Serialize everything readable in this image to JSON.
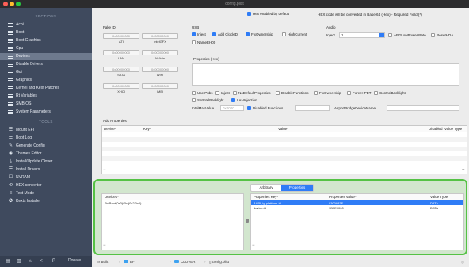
{
  "window": {
    "title": "config.plist"
  },
  "sidebar": {
    "sections_header": "SECTIONS",
    "items": [
      {
        "label": "Acpi"
      },
      {
        "label": "Boot"
      },
      {
        "label": "Boot Graphics"
      },
      {
        "label": "Cpu"
      },
      {
        "label": "Devices"
      },
      {
        "label": "Disable Drivers"
      },
      {
        "label": "Gui"
      },
      {
        "label": "Graphics"
      },
      {
        "label": "Kernel and Kext Patches"
      },
      {
        "label": "Rt Variables"
      },
      {
        "label": "SMBIOS"
      },
      {
        "label": "System Parameters"
      }
    ],
    "tools_header": "TOOLS",
    "tools": [
      {
        "label": "Mount EFI",
        "icon": "hdd-icon",
        "glyph": "☰"
      },
      {
        "label": "Boot Log",
        "icon": "log-icon",
        "glyph": "☰"
      },
      {
        "label": "Generate Config",
        "icon": "generate-icon",
        "glyph": "✎"
      },
      {
        "label": "Themes Editor",
        "icon": "themes-icon",
        "glyph": "◉"
      },
      {
        "label": "Install/Update Clover",
        "icon": "install-icon",
        "glyph": "⤓"
      },
      {
        "label": "Install Drivers",
        "icon": "drivers-icon",
        "glyph": "☰"
      },
      {
        "label": "NVRAM",
        "icon": "nvram-icon",
        "glyph": "☐"
      },
      {
        "label": "HEX converter",
        "icon": "hex-icon",
        "glyph": "⟲"
      },
      {
        "label": "Text Mode",
        "icon": "text-icon",
        "glyph": "≡"
      },
      {
        "label": "Kexts Installer",
        "icon": "kexts-icon",
        "glyph": "✪"
      }
    ],
    "donate": "Donate"
  },
  "top_bar": {
    "hex_checkbox": "Hex enabled by default",
    "hex_note": "HEX code will be converted in Base 64 (Hex) - Required Field (*)"
  },
  "fake_id": {
    "title": "Fake ID",
    "buttons": [
      {
        "value": "0x00000000",
        "caption": "ATI"
      },
      {
        "value": "0x00000000",
        "caption": "IntelGFX"
      },
      {
        "value": "0x00000000",
        "caption": "LAN"
      },
      {
        "value": "0x00000000",
        "caption": "NVidia"
      },
      {
        "value": "0x00000000",
        "caption": "SATA"
      },
      {
        "value": "0x00000000",
        "caption": "WIFI"
      },
      {
        "value": "0x00000000",
        "caption": "XHCI"
      },
      {
        "value": "0x00000000",
        "caption": "IMEI"
      }
    ]
  },
  "usb": {
    "title": "USB",
    "inject": "Inject",
    "add_clockid": "Add ClockID",
    "fix_ownership": "FixOwnership",
    "high_current": "HighCurrent",
    "name_ehci": "NameEH00"
  },
  "audio": {
    "title": "Audio",
    "inject_label": "Inject",
    "inject_value": "1",
    "afg_low_power": "AFGLowPowerState",
    "reset_hda": "ResetHDA"
  },
  "properties_hex": {
    "label": "Properties (Hex)"
  },
  "options": {
    "row1": [
      "Use Pubs",
      "Inject",
      "NoDefaultProperties",
      "DisableFunctions",
      "FixOwnership",
      "ForceHPET",
      "ControlBacklight"
    ],
    "row2": [
      "SetIntelBacklight",
      "LANInjection"
    ],
    "intel_max_backlight": "IntelMaxValue",
    "intel_max_value_placeholder": "0x0000",
    "disabled_functions": "Disabled Functions",
    "airport_bridge": "AirportBridgeDeviceName"
  },
  "add_properties": {
    "title": "Add Properties",
    "columns": [
      "Device*",
      "Key*",
      "Value*",
      "Disabled",
      "Value Type"
    ]
  },
  "custom": {
    "tabs": [
      "Arbitrary",
      "Properties"
    ],
    "left_columns": [
      "Devices*"
    ],
    "left_rows": [
      "PciRoot(0x0)/Pci(0x2,0x0)"
    ],
    "right_columns": [
      "Properties Key*",
      "Properties Value*",
      "Value Type"
    ],
    "right_rows": [
      {
        "key": "AAPL,ig-platform-id",
        "value": "0300983E",
        "type": "DATA",
        "selected": true
      },
      {
        "key": "device-id",
        "value": "9B3E0000",
        "type": "DATA",
        "selected": false
      }
    ]
  },
  "breadcrumb": [
    "EFI",
    "CLOVER",
    "config.plist"
  ],
  "breadcrumb_prefix": "Built",
  "colors": {
    "accent": "#2f7cf6",
    "sidebar": "#3f4a5e",
    "highlight_green": "#55c245"
  }
}
